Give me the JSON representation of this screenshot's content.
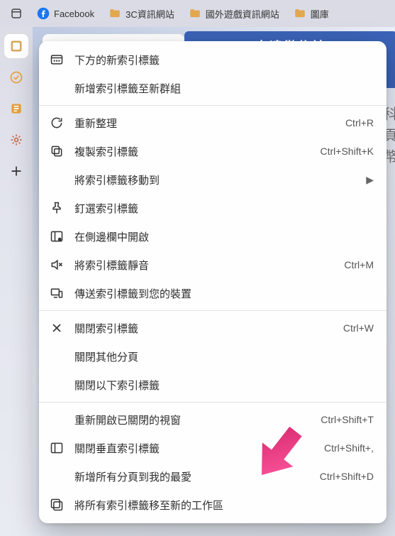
{
  "bookmarks": [
    {
      "label": "Facebook",
      "icon": "facebook"
    },
    {
      "label": "3C資訊網站",
      "icon": "folder"
    },
    {
      "label": "國外遊戲資訊網站",
      "icon": "folder"
    },
    {
      "label": "圖庫",
      "icon": "folder"
    }
  ],
  "banner_text": "立達徵信社",
  "side_text": "科頁幣",
  "context_menu": {
    "items": [
      {
        "label": "下方的新索引標籤",
        "icon": "tab-new",
        "shortcut": ""
      },
      {
        "label": "新增索引標籤至新群組",
        "icon": "",
        "shortcut": ""
      },
      {
        "sep": true
      },
      {
        "label": "重新整理",
        "icon": "reload",
        "shortcut": "Ctrl+R"
      },
      {
        "label": "複製索引標籤",
        "icon": "duplicate",
        "shortcut": "Ctrl+Shift+K"
      },
      {
        "label": "將索引標籤移動到",
        "icon": "",
        "submenu": true
      },
      {
        "label": "釘選索引標籤",
        "icon": "pin",
        "shortcut": ""
      },
      {
        "label": "在側邊欄中開啟",
        "icon": "sidebar",
        "shortcut": ""
      },
      {
        "label": "將索引標籤靜音",
        "icon": "mute",
        "shortcut": "Ctrl+M"
      },
      {
        "label": "傳送索引標籤到您的裝置",
        "icon": "devices",
        "shortcut": ""
      },
      {
        "sep": true
      },
      {
        "label": "關閉索引標籤",
        "icon": "close",
        "shortcut": "Ctrl+W"
      },
      {
        "label": "關閉其他分頁",
        "icon": "",
        "shortcut": ""
      },
      {
        "label": "關閉以下索引標籤",
        "icon": "",
        "shortcut": ""
      },
      {
        "sep": true
      },
      {
        "label": "重新開啟已關閉的視窗",
        "icon": "",
        "shortcut": "Ctrl+Shift+T"
      },
      {
        "label": "關閉垂直索引標籤",
        "icon": "vertical-tabs",
        "shortcut": "Ctrl+Shift+,"
      },
      {
        "label": "新增所有分頁到我的最愛",
        "icon": "",
        "shortcut": "Ctrl+Shift+D"
      },
      {
        "label": "將所有索引標籤移至新的工作區",
        "icon": "workspace",
        "shortcut": ""
      }
    ]
  }
}
